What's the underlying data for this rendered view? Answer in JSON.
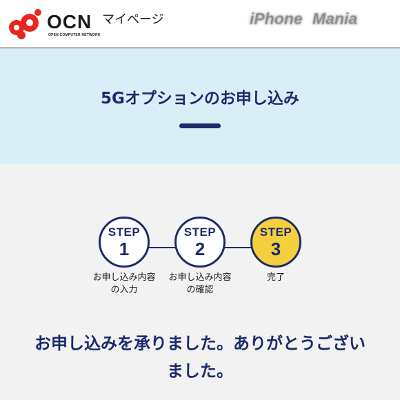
{
  "header": {
    "logo_text": "OCN",
    "logo_subtext": "OPEN COMPUTER NETWORK",
    "mypage_label": "マイページ",
    "watermark": "iPhone Mania"
  },
  "main": {
    "title": "5Gオプションのお申し込み"
  },
  "steps": [
    {
      "word": "STEP",
      "number": "1",
      "label_line1": "お申し込み内容",
      "label_line2": "の入力",
      "active": false
    },
    {
      "word": "STEP",
      "number": "2",
      "label_line1": "お申し込み内容",
      "label_line2": "の確認",
      "active": false
    },
    {
      "word": "STEP",
      "number": "3",
      "label_line1": "完了",
      "label_line2": "",
      "active": true
    }
  ],
  "message": {
    "line1": "お申し込みを承りました。ありがとうござい",
    "line2": "ました。"
  },
  "colors": {
    "navy": "#1b2a6b",
    "band": "#d9eff8",
    "active_step": "#f6cf3e",
    "logo_red": "#e8251e"
  }
}
